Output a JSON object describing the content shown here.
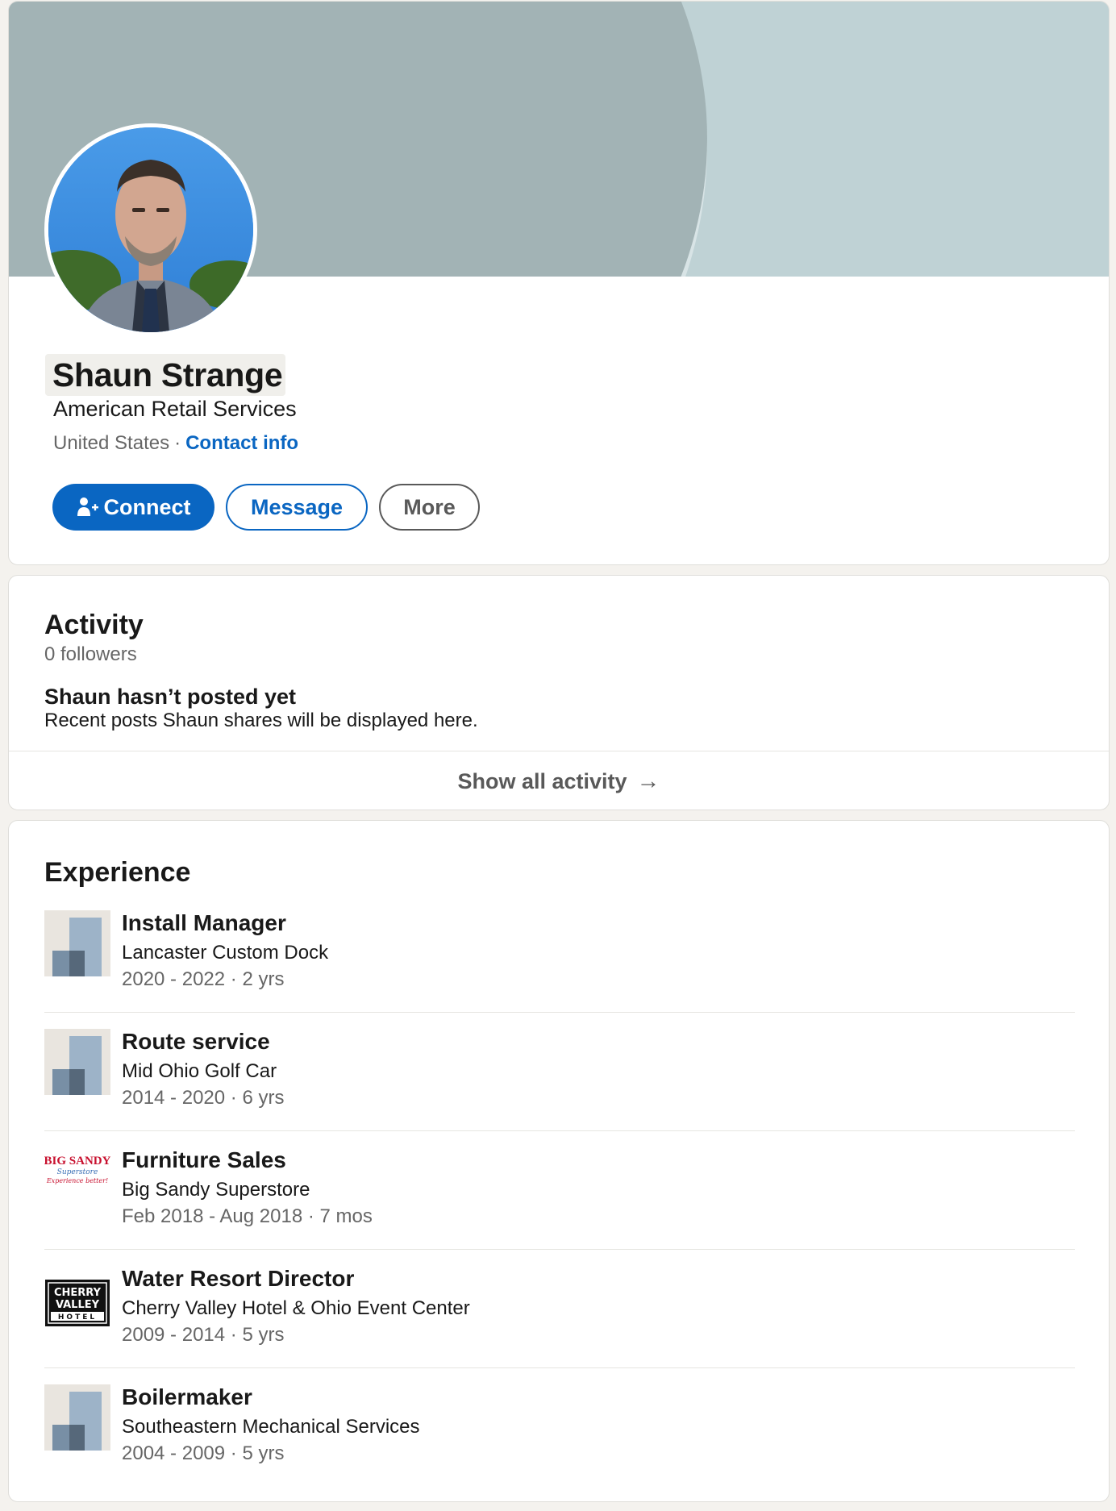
{
  "profile": {
    "name": "Shaun Strange",
    "headline": "American Retail Services",
    "location": "United States",
    "separator": "·",
    "contact_label": "Contact info"
  },
  "actions": {
    "connect_label": "Connect",
    "message_label": "Message",
    "more_label": "More"
  },
  "activity": {
    "title": "Activity",
    "followers": "0 followers",
    "empty_title": "Shaun hasn’t posted yet",
    "empty_desc": "Recent posts Shaun shares will be displayed here.",
    "show_all": "Show all activity",
    "arrow": "→"
  },
  "experience": {
    "title": "Experience",
    "items": [
      {
        "title": "Install Manager",
        "company": "Lancaster Custom Dock",
        "dates": "2020 - 2022 · 2 yrs",
        "logo": "generic-company-icon"
      },
      {
        "title": "Route service",
        "company": "Mid Ohio Golf Car",
        "dates": "2014 - 2020 · 6 yrs",
        "logo": "generic-company-icon"
      },
      {
        "title": "Furniture Sales",
        "company": "Big Sandy Superstore",
        "dates": "Feb 2018 - Aug 2018 · 7 mos",
        "logo": "big-sandy-logo"
      },
      {
        "title": "Water Resort Director",
        "company": "Cherry Valley Hotel & Ohio Event Center",
        "dates": "2009 - 2014 · 5 yrs",
        "logo": "cherry-valley-logo"
      },
      {
        "title": "Boilermaker",
        "company": "Southeastern Mechanical Services",
        "dates": "2004 - 2009 · 5 yrs",
        "logo": "generic-company-icon"
      }
    ]
  },
  "logos": {
    "big_sandy": {
      "line1": "BIG SANDY",
      "line2": "Superstore",
      "line3": "Experience better!"
    },
    "cherry_valley": {
      "line1": "CHERRY",
      "line2": "VALLEY",
      "line3": "HOTEL"
    }
  },
  "colors": {
    "accent": "#0a66c2",
    "banner": "#a2b3b5",
    "page_background": "#f4f2ee"
  }
}
